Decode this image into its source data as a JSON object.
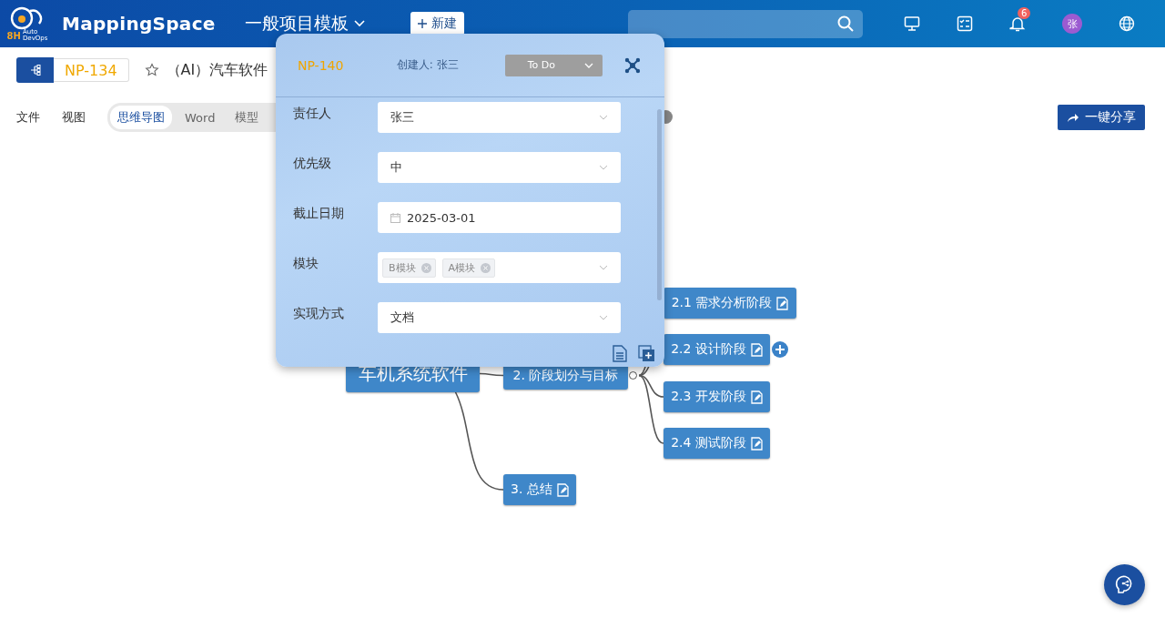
{
  "header": {
    "logo_mark": "8H",
    "logo_sub": [
      "Auto",
      "DevOps"
    ],
    "brand": "MappingSpace",
    "project": "一般项目模板",
    "new_button": "新建",
    "notifications": "6",
    "avatar": "张"
  },
  "doc": {
    "id": "NP-134",
    "title": "（AI）汽车软件",
    "starred": false
  },
  "menu": [
    "文件",
    "视图"
  ],
  "view_tabs": [
    {
      "label": "思维导图",
      "selected": true
    },
    {
      "label": "Word",
      "selected": false
    },
    {
      "label": "模型",
      "selected": false
    }
  ],
  "share_button": "一键分享",
  "mindmap": {
    "text": "车机系统软件",
    "children": [
      {
        "text": "2. 阶段划分与目标",
        "expanded": true,
        "children": [
          {
            "text": "2.1 需求分析阶段",
            "note": true,
            "hovered": false
          },
          {
            "text": "2.2 设计阶段",
            "note": true,
            "hovered": true
          },
          {
            "text": "2.3 开发阶段",
            "note": true,
            "hovered": false
          },
          {
            "text": "2.4 测试阶段",
            "note": true,
            "hovered": false
          }
        ]
      },
      {
        "text": "3. 总结",
        "note": true
      }
    ]
  },
  "popup": {
    "id": "NP-140",
    "creator": "创建人: 张三",
    "status": "To Do",
    "fields": [
      {
        "label": "责任人",
        "kind": "select",
        "value": "张三"
      },
      {
        "label": "优先级",
        "kind": "select",
        "value": "中"
      },
      {
        "label": "截止日期",
        "kind": "date",
        "value": "2025-03-01"
      },
      {
        "label": "模块",
        "kind": "tags",
        "tags": [
          "B模块",
          "A模块"
        ]
      },
      {
        "label": "实现方式",
        "kind": "select",
        "value": "文档"
      }
    ]
  }
}
